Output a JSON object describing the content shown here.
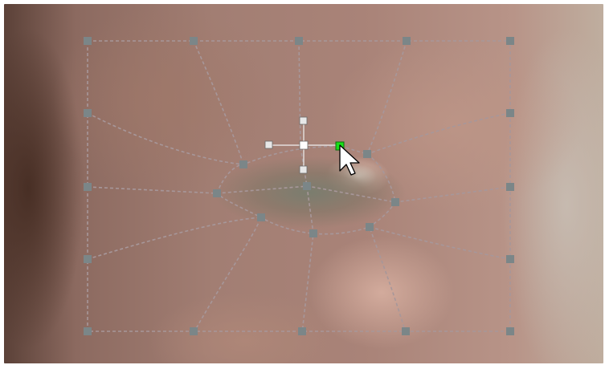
{
  "canvas": {
    "description_icon": "mesh-warp-editor",
    "cursor_icon": "arrow-cursor-icon"
  },
  "colors": {
    "grid_line": "#a7979a",
    "grid_node": "#7b8688",
    "selected_node": "#18e018",
    "handle": "#e7e7e7"
  }
}
